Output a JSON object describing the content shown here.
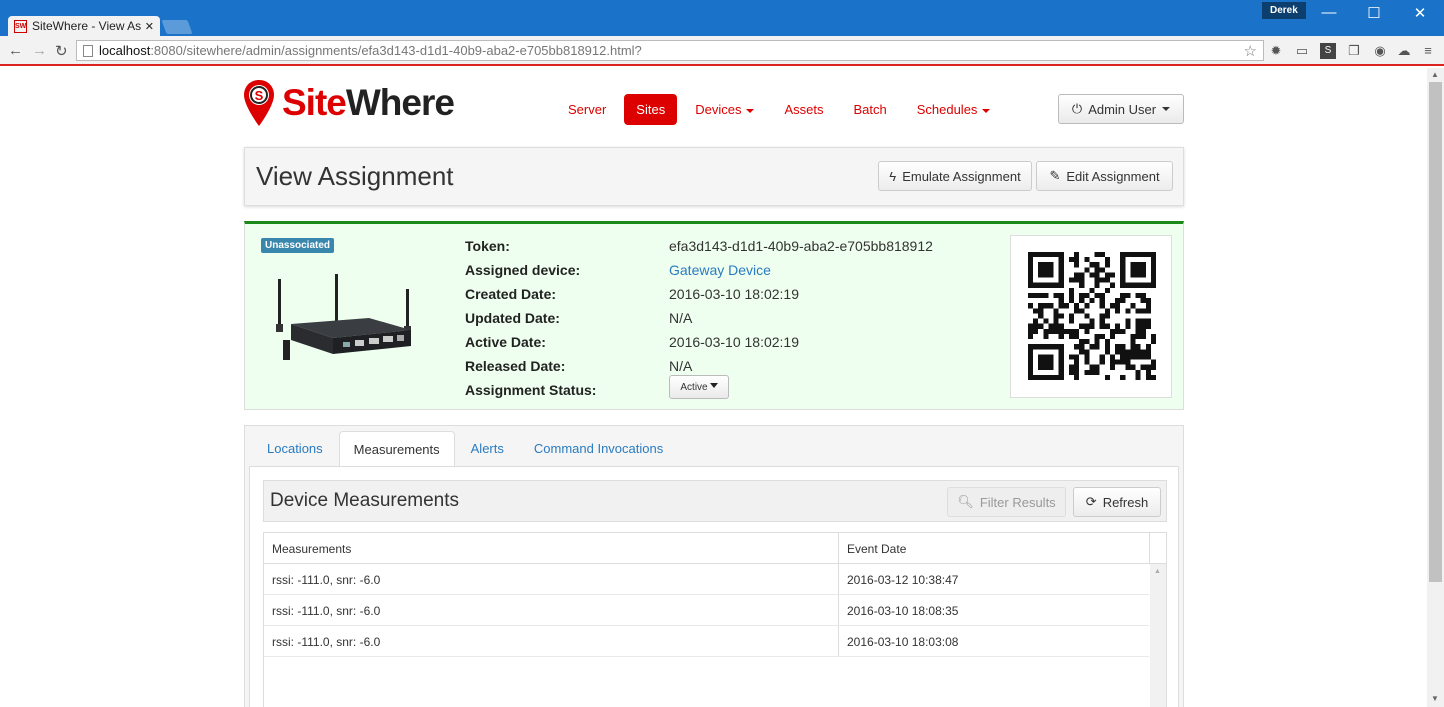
{
  "browser": {
    "tab_title": "SiteWhere - View Ass",
    "favicon_text": "SW",
    "url_host": "localhost",
    "url_path": ":8080/sitewhere/admin/assignments/efa3d143-d1d1-40b9-aba2-e705bb818912.html?",
    "profile_name": "Derek"
  },
  "header": {
    "logo_site": "Site",
    "logo_where": "Where",
    "nav": [
      {
        "label": "Server"
      },
      {
        "label": "Sites"
      },
      {
        "label": "Devices"
      },
      {
        "label": "Assets"
      },
      {
        "label": "Batch"
      },
      {
        "label": "Schedules"
      }
    ],
    "user_label": "Admin User"
  },
  "page": {
    "title": "View Assignment",
    "emulate_label": "Emulate Assignment",
    "edit_label": "Edit Assignment"
  },
  "assignment": {
    "badge": "Unassociated",
    "labels": {
      "token": "Token:",
      "device": "Assigned device:",
      "created": "Created Date:",
      "updated": "Updated Date:",
      "active": "Active Date:",
      "released": "Released Date:",
      "status": "Assignment Status:"
    },
    "token": "efa3d143-d1d1-40b9-aba2-e705bb818912",
    "device": "Gateway Device",
    "created": "2016-03-10 18:02:19",
    "updated": "N/A",
    "active": "2016-03-10 18:02:19",
    "released": "N/A",
    "status": "Active"
  },
  "tabs": [
    {
      "label": "Locations"
    },
    {
      "label": "Measurements"
    },
    {
      "label": "Alerts"
    },
    {
      "label": "Command Invocations"
    }
  ],
  "measurements": {
    "title": "Device Measurements",
    "filter_label": "Filter Results",
    "refresh_label": "Refresh",
    "columns": [
      "Measurements",
      "Event Date"
    ],
    "rows": [
      {
        "measurement": "rssi: -111.0, snr: -6.0",
        "date": "2016-03-12 10:38:47"
      },
      {
        "measurement": "rssi: -111.0, snr: -6.0",
        "date": "2016-03-10 18:08:35"
      },
      {
        "measurement": "rssi: -111.0, snr: -6.0",
        "date": "2016-03-10 18:03:08"
      }
    ]
  },
  "colors": {
    "brand_red": "#d00000",
    "chrome_blue": "#1a73c8",
    "success_green": "#1a8a1a",
    "info_badge": "#3a87ad",
    "link_blue": "#2a7bc0"
  }
}
